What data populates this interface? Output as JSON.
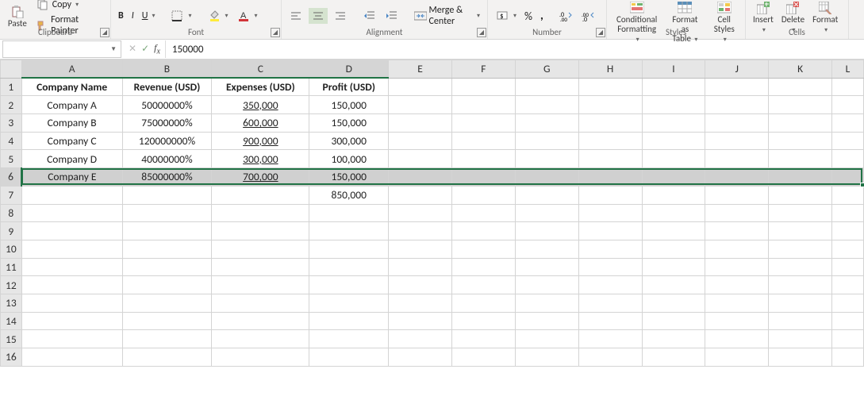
{
  "ribbon": {
    "paste_label": "Paste",
    "copy_label": "Copy",
    "fmtpainter_label": "Format Painter",
    "clipboard_group": "Clipboard",
    "font": {
      "bold": "B",
      "italic": "I",
      "underline": "U",
      "group": "Font"
    },
    "alignment": {
      "merge": "Merge & Center",
      "group": "Alignment"
    },
    "number": {
      "percent": "%",
      "comma": ",",
      "group": "Number"
    },
    "styles": {
      "cond": "Conditional",
      "cond2": "Formatting",
      "fmt": "Format as",
      "fmt2": "Table",
      "cell": "Cell",
      "cell2": "Styles",
      "group": "Styles"
    },
    "cells": {
      "insert": "Insert",
      "delete": "Delete",
      "format": "Format",
      "group": "Cells"
    }
  },
  "formula_bar": {
    "name_box": "",
    "value": "150000"
  },
  "columns": [
    "A",
    "B",
    "C",
    "D",
    "E",
    "F",
    "G",
    "H",
    "I",
    "J",
    "K",
    "L"
  ],
  "rows_visible": 16,
  "headers": {
    "A": "Company Name",
    "B": "Revenue (USD)",
    "C": "Expenses (USD)",
    "D": "Profit (USD)"
  },
  "data": [
    {
      "A": "Company A",
      "B": "50000000%",
      "C": "350,000",
      "D": "150,000"
    },
    {
      "A": "Company B",
      "B": "75000000%",
      "C": "600,000",
      "D": "150,000"
    },
    {
      "A": "Company C",
      "B": "120000000%",
      "C": "900,000",
      "D": "300,000"
    },
    {
      "A": "Company D",
      "B": "40000000%",
      "C": "300,000",
      "D": "100,000"
    },
    {
      "A": "Company E",
      "B": "85000000%",
      "C": "700,000",
      "D": "150,000"
    }
  ],
  "row7_D": "850,000",
  "selected_row": 6,
  "active_cell": "D6",
  "chart_data": {
    "type": "table",
    "columns": [
      "Company Name",
      "Revenue (USD)",
      "Expenses (USD)",
      "Profit (USD)"
    ],
    "rows": [
      [
        "Company A",
        "50000000%",
        "350,000",
        "150,000"
      ],
      [
        "Company B",
        "75000000%",
        "600,000",
        "150,000"
      ],
      [
        "Company C",
        "120000000%",
        "900,000",
        "300,000"
      ],
      [
        "Company D",
        "40000000%",
        "300,000",
        "100,000"
      ],
      [
        "Company E",
        "85000000%",
        "700,000",
        "150,000"
      ],
      [
        "",
        "",
        "",
        "850,000"
      ]
    ]
  }
}
